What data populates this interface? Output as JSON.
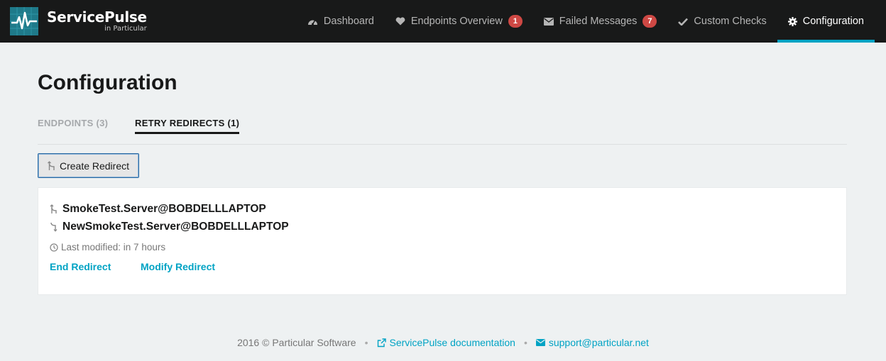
{
  "brand": {
    "title": "ServicePulse",
    "subtitle": "in Particular"
  },
  "nav": [
    {
      "label": "Dashboard",
      "icon": "dashboard-icon"
    },
    {
      "label": "Endpoints Overview",
      "icon": "heart-icon",
      "badge": "1"
    },
    {
      "label": "Failed Messages",
      "icon": "envelope-icon",
      "badge": "7"
    },
    {
      "label": "Custom Checks",
      "icon": "check-icon"
    },
    {
      "label": "Configuration",
      "icon": "gear-icon",
      "active": true
    }
  ],
  "page": {
    "title": "Configuration"
  },
  "tabs": [
    {
      "label": "ENDPOINTS (3)",
      "active": false
    },
    {
      "label": "RETRY REDIRECTS (1)",
      "active": true
    }
  ],
  "create_button": {
    "label": "Create Redirect",
    "icon": "redirect-icon"
  },
  "redirect": {
    "source": "SmokeTest.Server@BOBDELLLAPTOP",
    "destination": "NewSmokeTest.Server@BOBDELLLAPTOP",
    "modified": "Last modified: in 7 hours",
    "end_label": "End Redirect",
    "modify_label": "Modify Redirect"
  },
  "footer": {
    "copyright": "2016 © Particular Software",
    "docs_label": "ServicePulse documentation",
    "support_label": "support@particular.net"
  },
  "colors": {
    "navbar": "#181919",
    "accent": "#00a3c4",
    "badge": "#ce4844",
    "background": "#eef1f2"
  }
}
